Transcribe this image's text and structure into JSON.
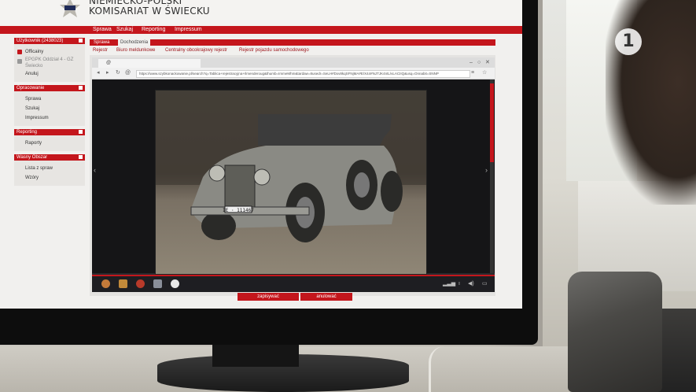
{
  "app": {
    "org_line1": "NIEMIECKO-POLSKI",
    "org_line2": "KOMISARIAT W ŚWIECKU",
    "badge_icon": "police-star-badge-icon"
  },
  "topnav": [
    "Sprawa",
    "Szukaj",
    "Reporting",
    "Impressum"
  ],
  "sidebar": {
    "user_header": "Użytkownik (2438023)",
    "user_items": [
      {
        "label": "Officainy",
        "icon": "user-icon"
      },
      {
        "label": "EPGPK Oddział 4 - GZ Świecko",
        "icon": "building-icon"
      },
      {
        "label": "Anuluj",
        "icon": ""
      }
    ],
    "sections": [
      {
        "title": "Opracowanie",
        "items": [
          "Sprawa",
          "Szukaj",
          "Impressum"
        ]
      },
      {
        "title": "Reporting",
        "items": [
          "Raporty"
        ]
      },
      {
        "title": "Wasny Obszar",
        "items": [
          "Lista z spraw",
          "Wzóry"
        ]
      }
    ]
  },
  "tabs": {
    "active": "Sprawa",
    "second": "Dochodzenia"
  },
  "subtabs": [
    "Rejestr",
    "Biuro meldunkowe",
    "Centralny obcokrajowy rejestr",
    "Rejestr pojazdu samochodowego"
  ],
  "browser": {
    "tab_title": "@",
    "url": "https://www.szybkonackowanie.pl/search?q=Tablica+rejestracyjna+Ilmenderoug&thumb=ImmeMhm&tardaw=8usedr=SeLH#Dxv8kqSFNjMA#E/X44#NJTJK4ntL/vLACIIQ&usq=Onnabit=SNNP"
  },
  "photo": {
    "plate": "IE · 111467"
  },
  "buttons": {
    "save": "zapisywać",
    "cancel": "anulować"
  },
  "colors": {
    "accent": "#c4161c"
  }
}
